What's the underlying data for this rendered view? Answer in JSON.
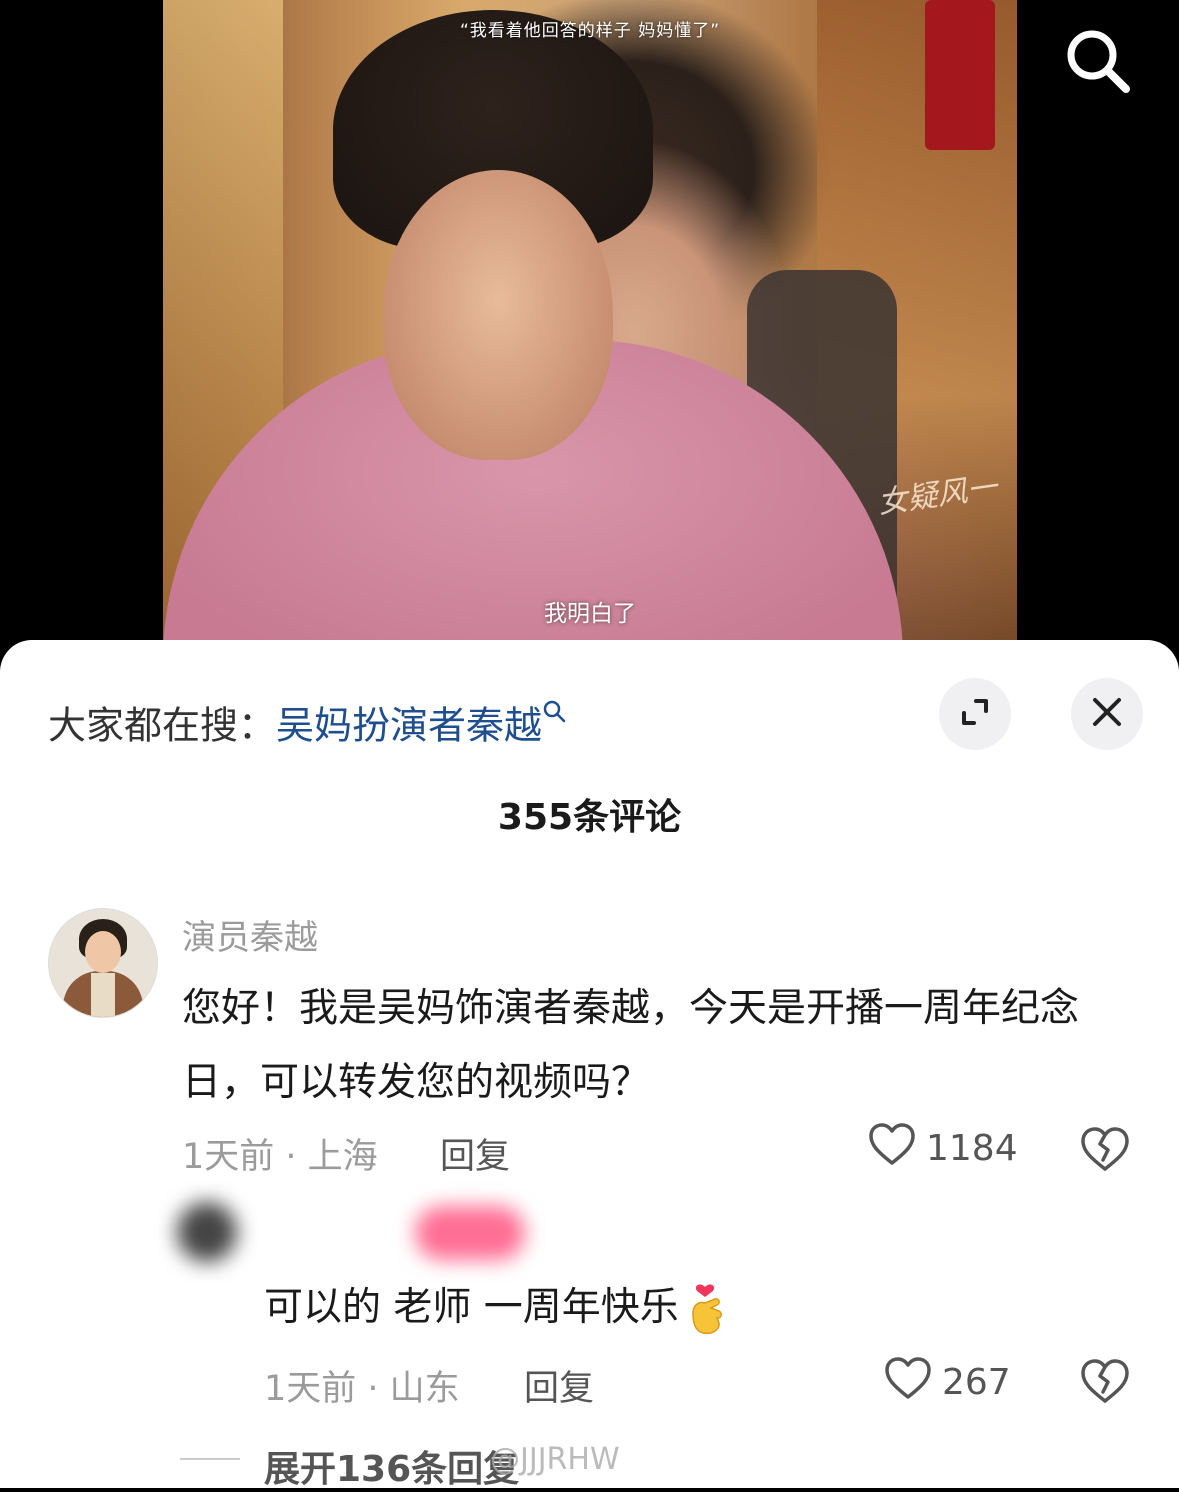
{
  "video": {
    "top_caption": "“我看着他回答的样子 妈妈懂了”",
    "subtitle": "我明白了",
    "watermark": "女疑风一"
  },
  "search_bar": {
    "prefix": "大家都在搜：",
    "keyword": "吴妈扮演者秦越"
  },
  "comments_header": {
    "title": "355条评论"
  },
  "main_comment": {
    "author": "演员秦越",
    "text": "您好！我是吴妈饰演者秦越，今天是开播一周年纪念日，可以转发您的视频吗？",
    "meta": "1天前 · 上海",
    "reply_label": "回复",
    "likes": "1184"
  },
  "reply_comment": {
    "text": "可以的 老师 一周年快乐",
    "meta": "1天前 · 山东",
    "reply_label": "回复",
    "likes": "267"
  },
  "expand_replies": {
    "label": "展开136条回复"
  },
  "watermark_text": "@JJJRHW",
  "icons": {
    "search": "search-icon",
    "expand": "expand-icon",
    "close": "close-icon",
    "like": "heart-icon",
    "dislike": "broken-heart-icon",
    "finger_heart": "finger-heart-emoji"
  },
  "colors": {
    "keyword_link": "#1f4e8e",
    "sheet_bg": "#ffffff",
    "muted_text": "#9b9b9b"
  }
}
